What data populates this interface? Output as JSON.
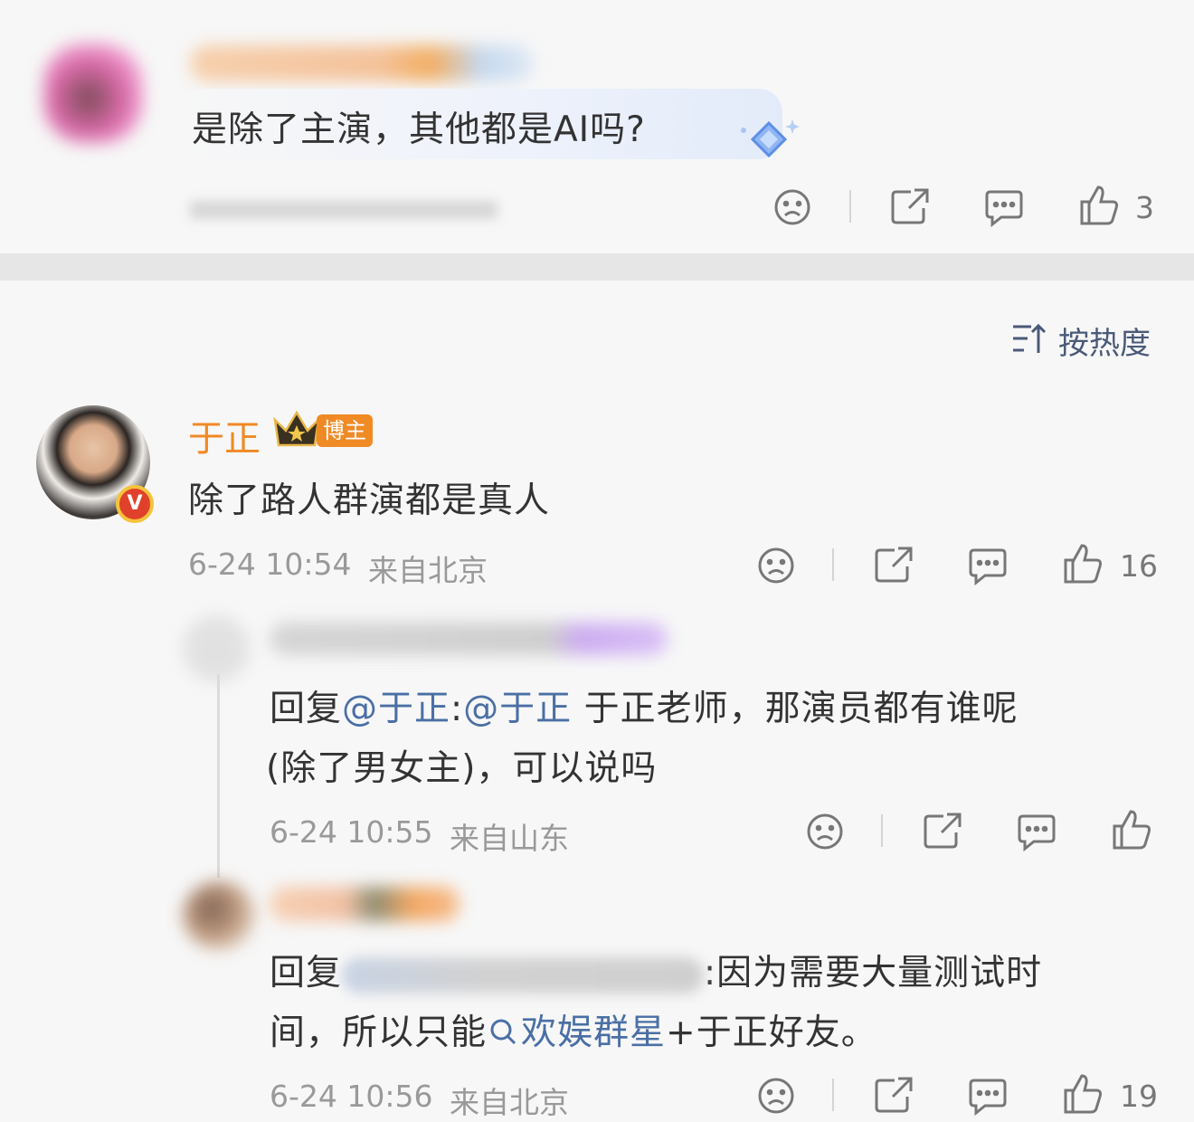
{
  "top_comment": {
    "text": "是除了主演，其他都是AI吗?",
    "likes": "3"
  },
  "sort": {
    "label": "按热度"
  },
  "main_comment": {
    "author": "于正",
    "badge": "博主",
    "text": "除了路人群演都是真人",
    "time": "6-24 10:54",
    "location": "来自北京",
    "likes": "16"
  },
  "reply1": {
    "prefix": "回复",
    "mention1": "@于正",
    "colon": ":",
    "mention2": "@于正",
    "text_line1": " 于正老师，那演员都有谁呢",
    "text_line2": "(除了男女主)，可以说吗",
    "time": "6-24 10:55",
    "location": "来自山东"
  },
  "reply2": {
    "prefix": "回复",
    "text_line1_after": ":因为需要大量测试时",
    "text_line2_before": "间，所以只能",
    "search_link": "欢娱群星",
    "text_line2_after": "+于正好友。",
    "time": "6-24 10:56",
    "location": "来自北京",
    "likes": "19"
  },
  "colors": {
    "accent_orange": "#f08a24",
    "mention_blue": "#4a6fa5",
    "verified_red": "#e0412a"
  }
}
